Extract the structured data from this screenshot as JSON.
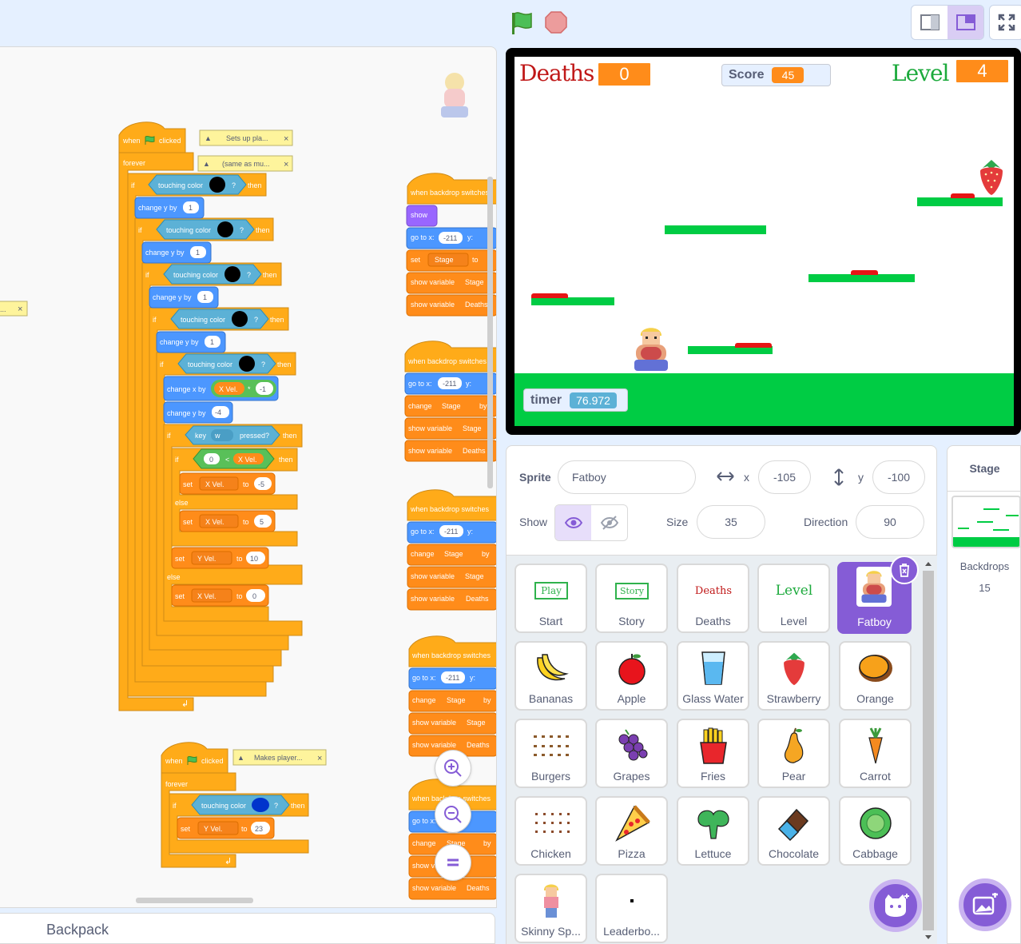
{
  "toolbar": {
    "green_flag_icon": "green-flag-icon",
    "stop_icon": "stop-icon",
    "small_stage_icon": "small-stage-icon",
    "normal_stage_icon": "normal-stage-icon",
    "fullscreen_icon": "fullscreen-icon"
  },
  "code": {
    "script1": {
      "hat": [
        "when",
        "clicked"
      ],
      "comment1": "Sets up pla...",
      "comment2": "(same as mu...",
      "forever": "forever",
      "if": "if",
      "then": "then",
      "else": "else",
      "touching_color": "touching color",
      "question": "?",
      "change_y_by": "change y by",
      "change_x_by": "change x by",
      "one": "1",
      "minus_one": "-1",
      "minus_four": "-4",
      "x_vel": "X Vel.",
      "y_vel": "Y Vel.",
      "times": "*",
      "key": "key",
      "key_w": "w",
      "pressed": "pressed?",
      "zero": "0",
      "lt": "<",
      "set": "set",
      "to": "to",
      "minus_five": "-5",
      "five": "5",
      "ten": "10",
      "zero2": "0"
    },
    "script2": {
      "hat": [
        "when",
        "clicked"
      ],
      "comment": "Makes player...",
      "forever": "forever",
      "if": "if",
      "touching_color": "touching color",
      "question": "?",
      "then": "then",
      "set": "set",
      "y_vel": "Y Vel.",
      "to": "to",
      "value": "23"
    },
    "side_scripts": {
      "when_backdrop": "when backdrop switches",
      "show": "show",
      "go_to_x": "go to x:",
      "x_val": "-211",
      "y": "y:",
      "set": "set",
      "stage": "Stage",
      "to": "to",
      "change": "change",
      "by": "by",
      "show_variable": "show variable",
      "deaths": "Deaths"
    },
    "left_comment_close": "×",
    "left_comment_dots": "..."
  },
  "backpack": {
    "label": "Backpack"
  },
  "stage": {
    "deaths_title": "Deaths",
    "deaths_value": "0",
    "score_label": "Score",
    "score_value": "45",
    "level_title": "Level",
    "level_value": "4",
    "timer_label": "timer",
    "timer_value": "76.972"
  },
  "sprite_info": {
    "sprite_label": "Sprite",
    "sprite_name": "Fatboy",
    "x_label": "x",
    "x_value": "-105",
    "y_label": "y",
    "y_value": "-100",
    "show_label": "Show",
    "size_label": "Size",
    "size_value": "35",
    "direction_label": "Direction",
    "direction_value": "90"
  },
  "sprites": [
    {
      "name": "Start",
      "thumb": "Play"
    },
    {
      "name": "Story",
      "thumb": "Story"
    },
    {
      "name": "Deaths",
      "thumb": "Deaths"
    },
    {
      "name": "Level",
      "thumb": "Level"
    },
    {
      "name": "Fatboy",
      "thumb": ""
    },
    {
      "name": "Bananas",
      "thumb": ""
    },
    {
      "name": "Apple",
      "thumb": ""
    },
    {
      "name": "Glass Water",
      "thumb": ""
    },
    {
      "name": "Strawberry",
      "thumb": ""
    },
    {
      "name": "Orange",
      "thumb": ""
    },
    {
      "name": "Burgers",
      "thumb": ""
    },
    {
      "name": "Grapes",
      "thumb": ""
    },
    {
      "name": "Fries",
      "thumb": ""
    },
    {
      "name": "Pear",
      "thumb": ""
    },
    {
      "name": "Carrot",
      "thumb": ""
    },
    {
      "name": "Chicken",
      "thumb": ""
    },
    {
      "name": "Pizza",
      "thumb": ""
    },
    {
      "name": "Lettuce",
      "thumb": ""
    },
    {
      "name": "Chocolate",
      "thumb": ""
    },
    {
      "name": "Cabbage",
      "thumb": ""
    },
    {
      "name": "Skinny Sp...",
      "thumb": ""
    },
    {
      "name": "Leaderbo...",
      "thumb": ""
    }
  ],
  "stage_panel": {
    "title": "Stage",
    "backdrops_label": "Backdrops",
    "backdrops_count": "15"
  },
  "colors": {
    "accent": "#855cd6",
    "motion": "#4c97ff",
    "control": "#ffab19",
    "sensing": "#5cb1d6",
    "variables": "#ff8c1a",
    "operators": "#59c059",
    "platform": "#00cc44",
    "lava": "#e61515"
  }
}
